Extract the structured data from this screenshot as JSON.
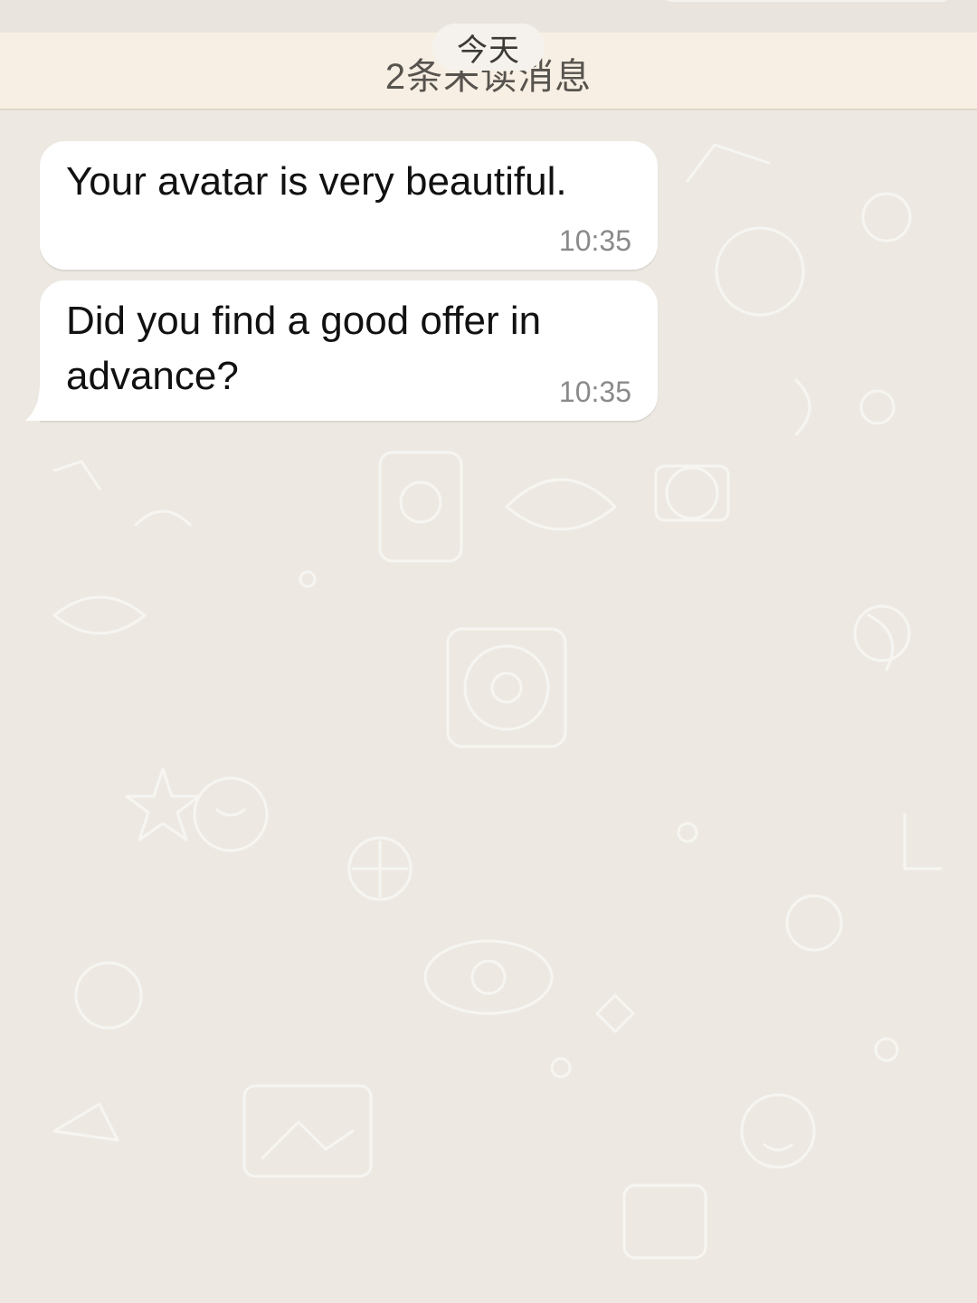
{
  "banner": {
    "unread_text": "2条未读消息",
    "date_label": "今天"
  },
  "messages": [
    {
      "text": "Your avatar is very beautiful.",
      "time": "10:35",
      "direction": "incoming"
    },
    {
      "text": "Did you find a good offer in advance?",
      "time": "10:35",
      "direction": "incoming"
    }
  ],
  "colors": {
    "chat_background": "#ede9e2",
    "banner_background": "#f7efe3",
    "bubble_incoming": "#ffffff",
    "timestamp": "#8a8a8a"
  }
}
